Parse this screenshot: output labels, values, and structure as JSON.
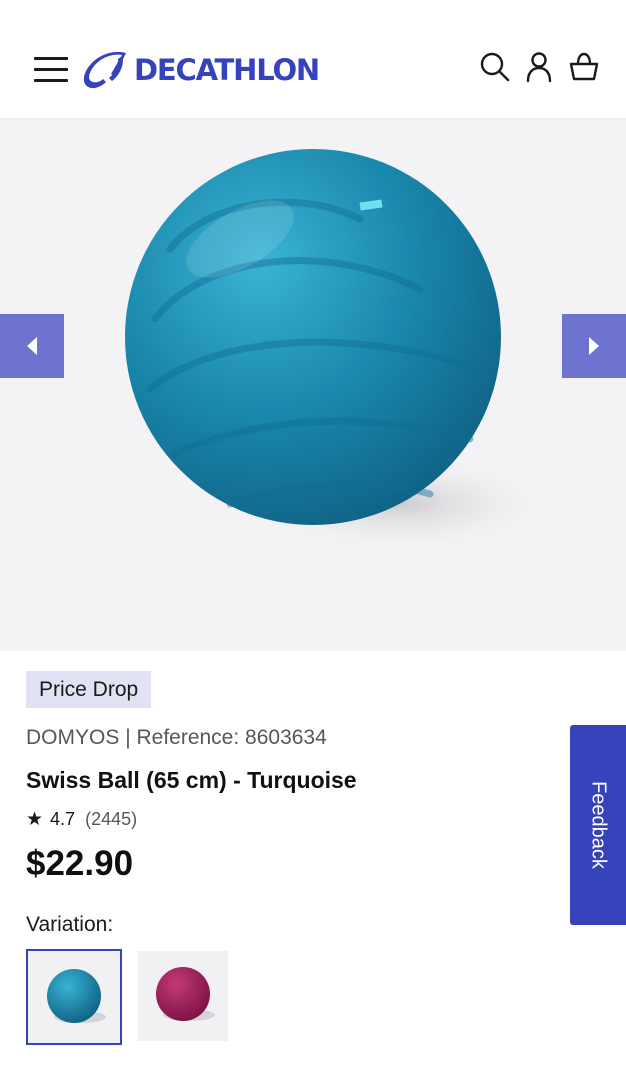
{
  "header": {
    "brand": "DECATHLON",
    "icons": [
      "menu-icon",
      "search-icon",
      "account-icon",
      "basket-icon"
    ]
  },
  "gallery": {
    "prev_icon": "chevron-left-icon",
    "next_icon": "chevron-right-icon",
    "ball_color": "#1d8cb0"
  },
  "product": {
    "badge": "Price Drop",
    "brand": "DOMYOS",
    "reference": "| Reference: 8603634",
    "title": "Swiss Ball (65 cm) - Turquoise",
    "rating_star": "★",
    "rating": "4.7",
    "review_count": "(2445)",
    "price": "$22.90",
    "variation_label": "Variation:",
    "variations": [
      {
        "color": "turquoise",
        "selected": true
      },
      {
        "color": "magenta",
        "selected": false
      }
    ]
  },
  "feedback": {
    "label": "Feedback"
  },
  "colors": {
    "brand_blue": "#3643ba",
    "arrow_bg": "#6e73cf",
    "badge_bg": "#e1e2f4",
    "hero_bg": "#f3f3f5"
  }
}
